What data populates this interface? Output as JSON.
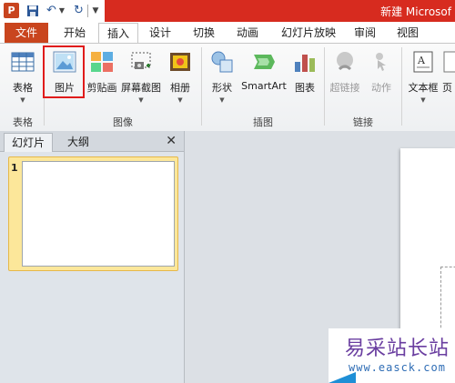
{
  "titlebar": {
    "title": "新建 Microsof",
    "app_icon_text": "P"
  },
  "tabs": {
    "file": "文件",
    "items": [
      "开始",
      "插入",
      "设计",
      "切换",
      "动画",
      "幻灯片放映",
      "审阅",
      "视图"
    ],
    "active": "插入"
  },
  "ribbon": {
    "buttons": {
      "table": "表格",
      "picture": "图片",
      "clipart": "剪贴画",
      "screenshot": "屏幕截图",
      "album": "相册",
      "shapes": "形状",
      "smartart": "SmartArt",
      "chart": "图表",
      "hyperlink": "超链接",
      "action": "动作",
      "textbox": "文本框",
      "header_partial": "页"
    },
    "groups": {
      "tables": "表格",
      "images": "图像",
      "illustrations": "插图",
      "links": "链接"
    }
  },
  "panel": {
    "tab_slides": "幻灯片",
    "tab_outline": "大纲",
    "close": "✕",
    "slide_number": "1"
  },
  "watermark": {
    "text": "易采站长站",
    "url": "www.easck.com"
  },
  "colors": {
    "title_red": "#d72b1f",
    "file_tab": "#c9451e",
    "highlight": "#e01b1b",
    "slide_select": "#fce79a"
  }
}
